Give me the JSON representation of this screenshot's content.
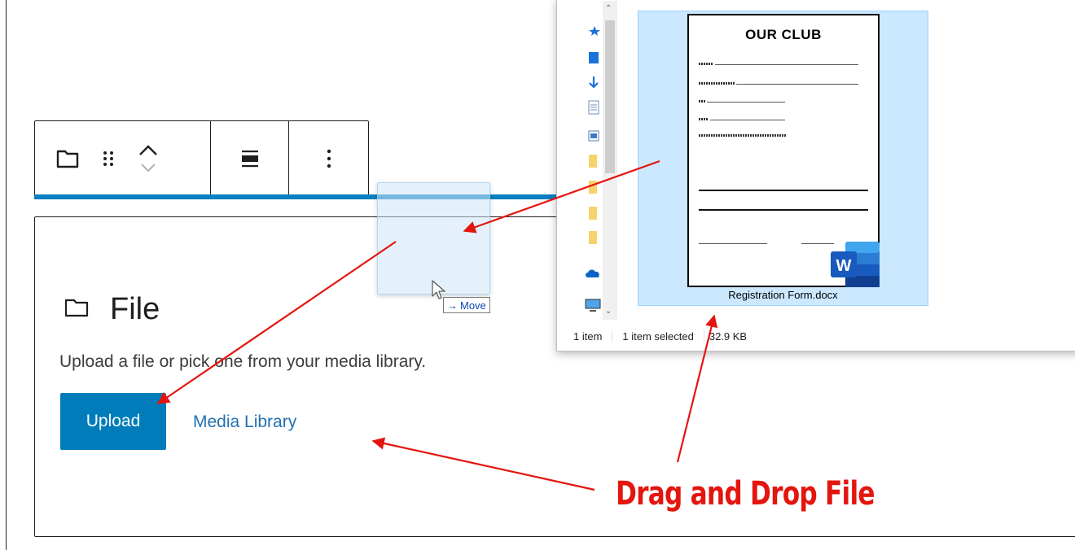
{
  "toolbar": {
    "icons": [
      "folder-icon",
      "drag-handle-icon",
      "move-up-icon",
      "move-down-icon",
      "align-icon",
      "more-options-icon"
    ]
  },
  "file_block": {
    "title": "File",
    "description": "Upload a file or pick one from your media library.",
    "upload_label": "Upload",
    "media_library_label": "Media Library"
  },
  "drag": {
    "tooltip": "Move"
  },
  "explorer": {
    "document_heading": "OUR CLUB",
    "file_name": "Registration Form.docx",
    "status": {
      "items": "1 item",
      "selected": "1 item selected",
      "size": "32.9 KB"
    }
  },
  "annotation": {
    "label": "Drag and Drop File",
    "color": "#e4150e"
  },
  "colors": {
    "primary_button": "#007cba",
    "link": "#2271b1",
    "selection": "#cce8ff",
    "block_border": "#1e1e1e"
  }
}
